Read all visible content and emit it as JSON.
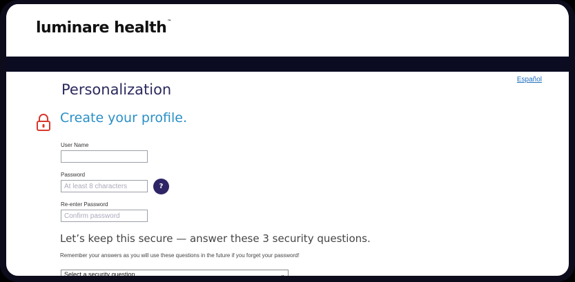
{
  "brand": {
    "logo_text": "luminare health",
    "tm": "™"
  },
  "language_link": "Español",
  "page": {
    "title": "Personalization",
    "subtitle": "Create your profile."
  },
  "form": {
    "username": {
      "label": "User Name",
      "value": "",
      "placeholder": ""
    },
    "password": {
      "label": "Password",
      "value": "",
      "placeholder": "At least 8 characters"
    },
    "confirm": {
      "label": "Re-enter Password",
      "value": "",
      "placeholder": "Confirm password"
    },
    "help_button_label": "?"
  },
  "security": {
    "heading": "Let’s keep this secure — answer these 3 security questions.",
    "note": "Remember your answers as you will use these questions in the future if you forget your password!",
    "select_value": "Select a security question"
  },
  "colors": {
    "navband": "#0b0b22",
    "title": "#2c2a5e",
    "subtitle": "#2a8fc7",
    "help_button": "#2e2566",
    "lock_icon": "#d9372b"
  },
  "icons": {
    "lock": "lock-icon",
    "dropdown": "chevron-down-icon"
  }
}
